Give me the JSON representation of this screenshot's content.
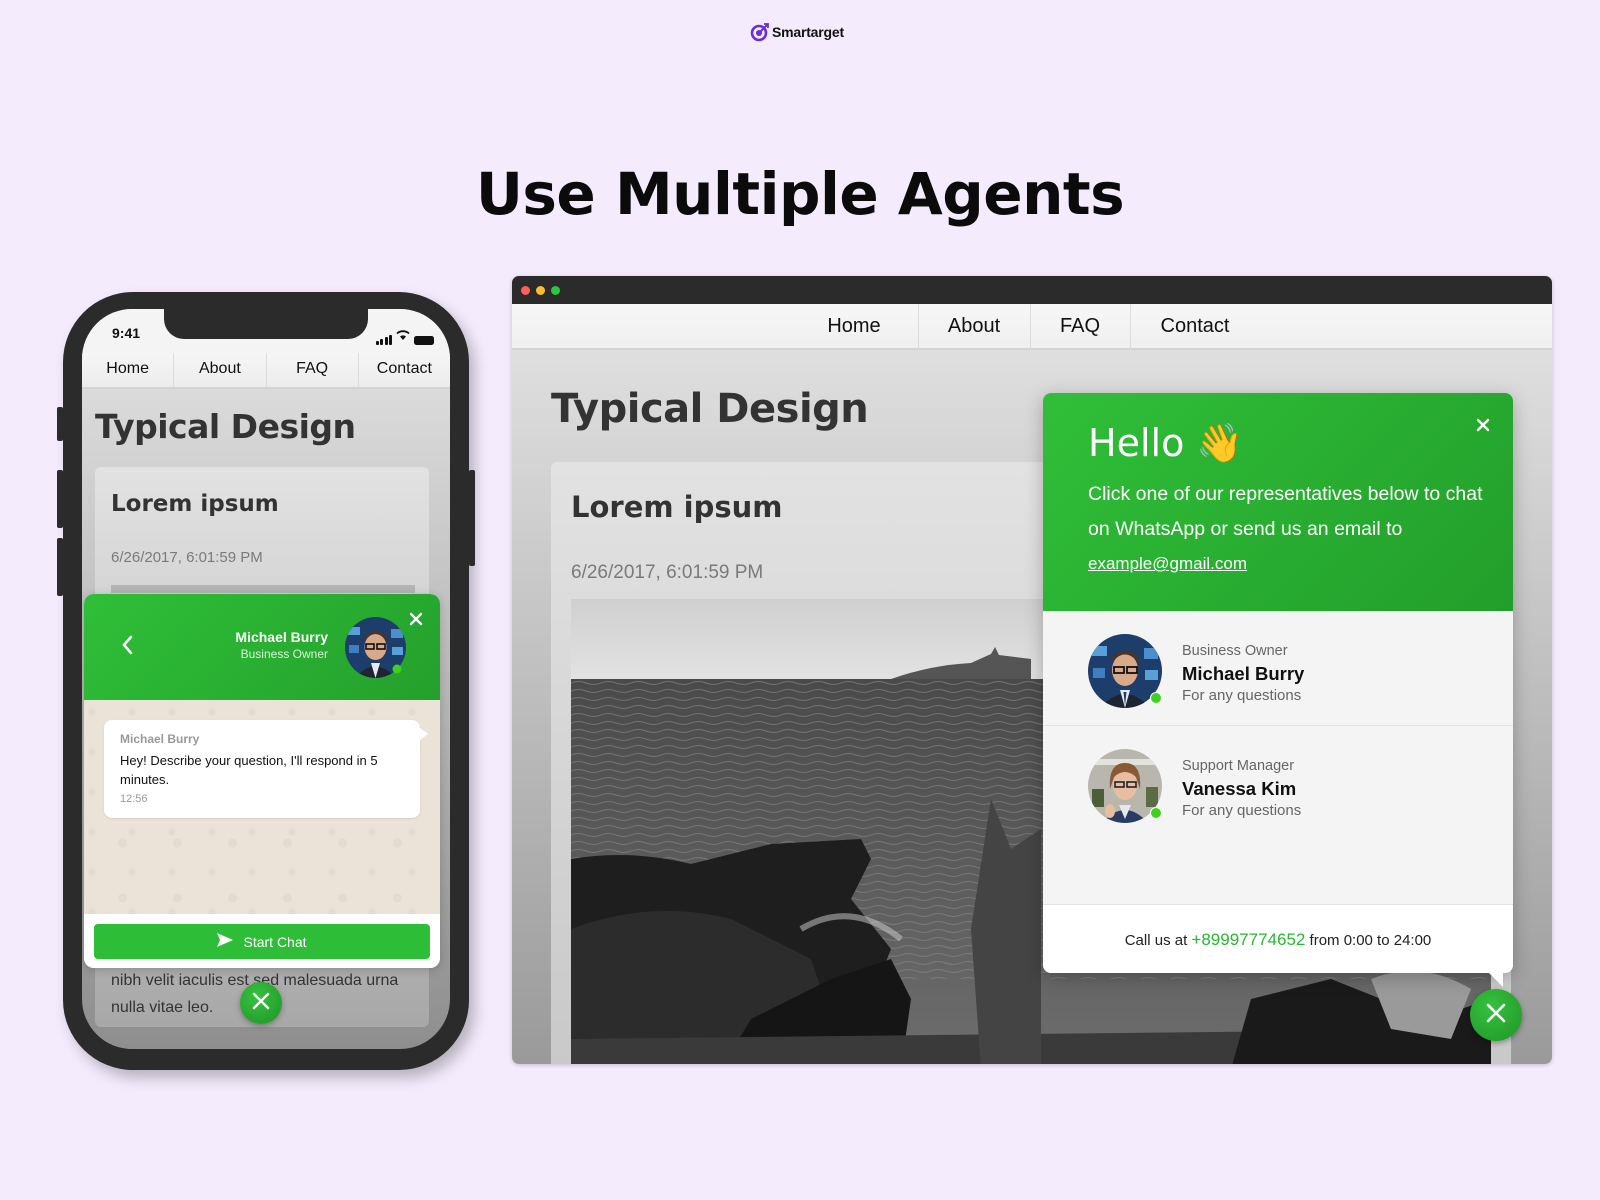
{
  "brand": {
    "name": "Smartarget",
    "accent": "#6b2cd9"
  },
  "headline": "Use Multiple Agents",
  "colors": {
    "green": "#2dbd37",
    "online": "#3cd21d",
    "background": "#f4ecfd"
  },
  "nav": [
    "Home",
    "About",
    "FAQ",
    "Contact"
  ],
  "page": {
    "title": "Typical Design",
    "post_title": "Lorem ipsum",
    "post_date": "6/26/2017, 6:01:59 PM",
    "post_excerpt": "nibh velit iaculis est sed malesuada urna nulla vitae leo."
  },
  "phone": {
    "status_time": "9:41",
    "chat": {
      "agent_name": "Michael Burry",
      "agent_role": "Business Owner",
      "message_sender": "Michael Burry",
      "message": "Hey! Describe your question, I'll respond in 5 minutes.",
      "message_time": "12:56",
      "start_button": "Start Chat"
    }
  },
  "widget": {
    "greeting": "Hello",
    "greeting_emoji": "👋",
    "description": "Click one of our representatives below to chat on WhatsApp or send us an email to",
    "email": "example@gmail.com",
    "agents": [
      {
        "role": "Business Owner",
        "name": "Michael Burry",
        "note": "For any questions",
        "online": true
      },
      {
        "role": "Support Manager",
        "name": "Vanessa Kim",
        "note": "For any questions",
        "online": true
      }
    ],
    "footer": {
      "prefix": "Call us at",
      "phone": "+89997774652",
      "suffix": "from 0:00 to 24:00"
    }
  }
}
